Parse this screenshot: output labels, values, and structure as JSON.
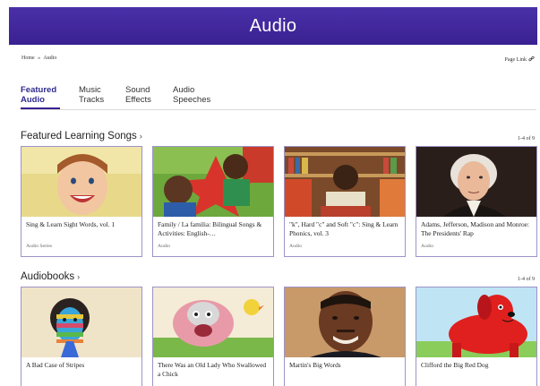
{
  "header": {
    "title": "Audio"
  },
  "breadcrumb": {
    "home": "Home",
    "sep": "»",
    "current": "Audio"
  },
  "page_link": {
    "label": "Page Link",
    "icon": "link-icon"
  },
  "tabs": [
    {
      "line1": "Featured",
      "line2": "Audio",
      "active": true
    },
    {
      "line1": "Music",
      "line2": "Tracks",
      "active": false
    },
    {
      "line1": "Sound",
      "line2": "Effects",
      "active": false
    },
    {
      "line1": "Audio",
      "line2": "Speeches",
      "active": false
    }
  ],
  "featured": {
    "title": "Featured Learning Songs",
    "count": "1-4 of 9",
    "cards": [
      {
        "title": "Sing & Learn Sight Words, vol. 1",
        "meta": "Audio Series"
      },
      {
        "title": "Family / La familia: Bilingual Songs & Activities: English-…",
        "meta": "Audio"
      },
      {
        "title": "\"k\", Hard \"c\" and Soft \"c\": Sing & Learn Phonics, vol. 3",
        "meta": "Audio"
      },
      {
        "title": "Adams, Jefferson, Madison and Monroe: The Presidents' Rap",
        "meta": "Audio"
      }
    ]
  },
  "audiobooks": {
    "title": "Audiobooks",
    "count": "1-4 of 9",
    "cards": [
      {
        "title": "A Bad Case of Stripes",
        "meta": ""
      },
      {
        "title": "There Was an Old Lady Who Swallowed a Chick",
        "meta": ""
      },
      {
        "title": "Martin's Big Words",
        "meta": ""
      },
      {
        "title": "Clifford the Big Red Dog",
        "meta": ""
      }
    ]
  },
  "colors": {
    "header": "#3a2191",
    "accent": "#2f2a8f",
    "card_border": "#9d93c8"
  }
}
